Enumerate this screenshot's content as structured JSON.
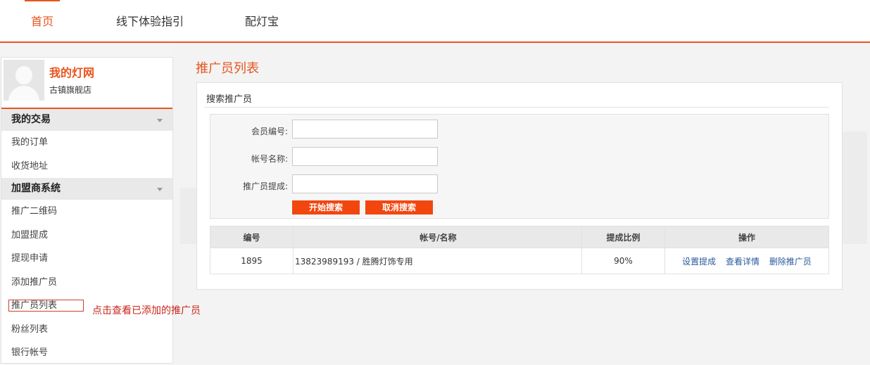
{
  "nav": [
    {
      "label": "首页",
      "active": true
    },
    {
      "label": "线下体验指引",
      "active": false
    },
    {
      "label": "配灯宝",
      "active": false
    }
  ],
  "profile": {
    "site_name": "我的灯网",
    "shop_name": "古镇旗舰店"
  },
  "sidebar": {
    "groups": [
      {
        "title": "我的交易",
        "items": [
          "我的订单",
          "收货地址"
        ]
      },
      {
        "title": "加盟商系统",
        "items": [
          "推广二维码",
          "加盟提成",
          "提现申请",
          "添加推广员",
          "推广员列表",
          "粉丝列表",
          "银行帐号"
        ]
      }
    ]
  },
  "callout": "点击查看已添加的推广员",
  "page_title": "推广员列表",
  "search": {
    "title": "搜索推广员",
    "fields": [
      {
        "label": "会员编号:",
        "value": ""
      },
      {
        "label": "帐号名称:",
        "value": ""
      },
      {
        "label": "推广员提成:",
        "value": ""
      }
    ],
    "search_button": "开始搜索",
    "cancel_button": "取消搜索"
  },
  "table": {
    "headers": [
      "编号",
      "帐号/名称",
      "提成比例",
      "操作"
    ],
    "rows": [
      {
        "id": "1895",
        "account": "13823989193 / 胜腾灯饰专用",
        "ratio": "90%",
        "actions": [
          "设置提成",
          "查看详情",
          "删除推广员"
        ]
      }
    ]
  },
  "colors": {
    "accent": "#e8541e",
    "button": "#f2460f",
    "link": "#2a5a9c",
    "callout": "#c8261b"
  }
}
